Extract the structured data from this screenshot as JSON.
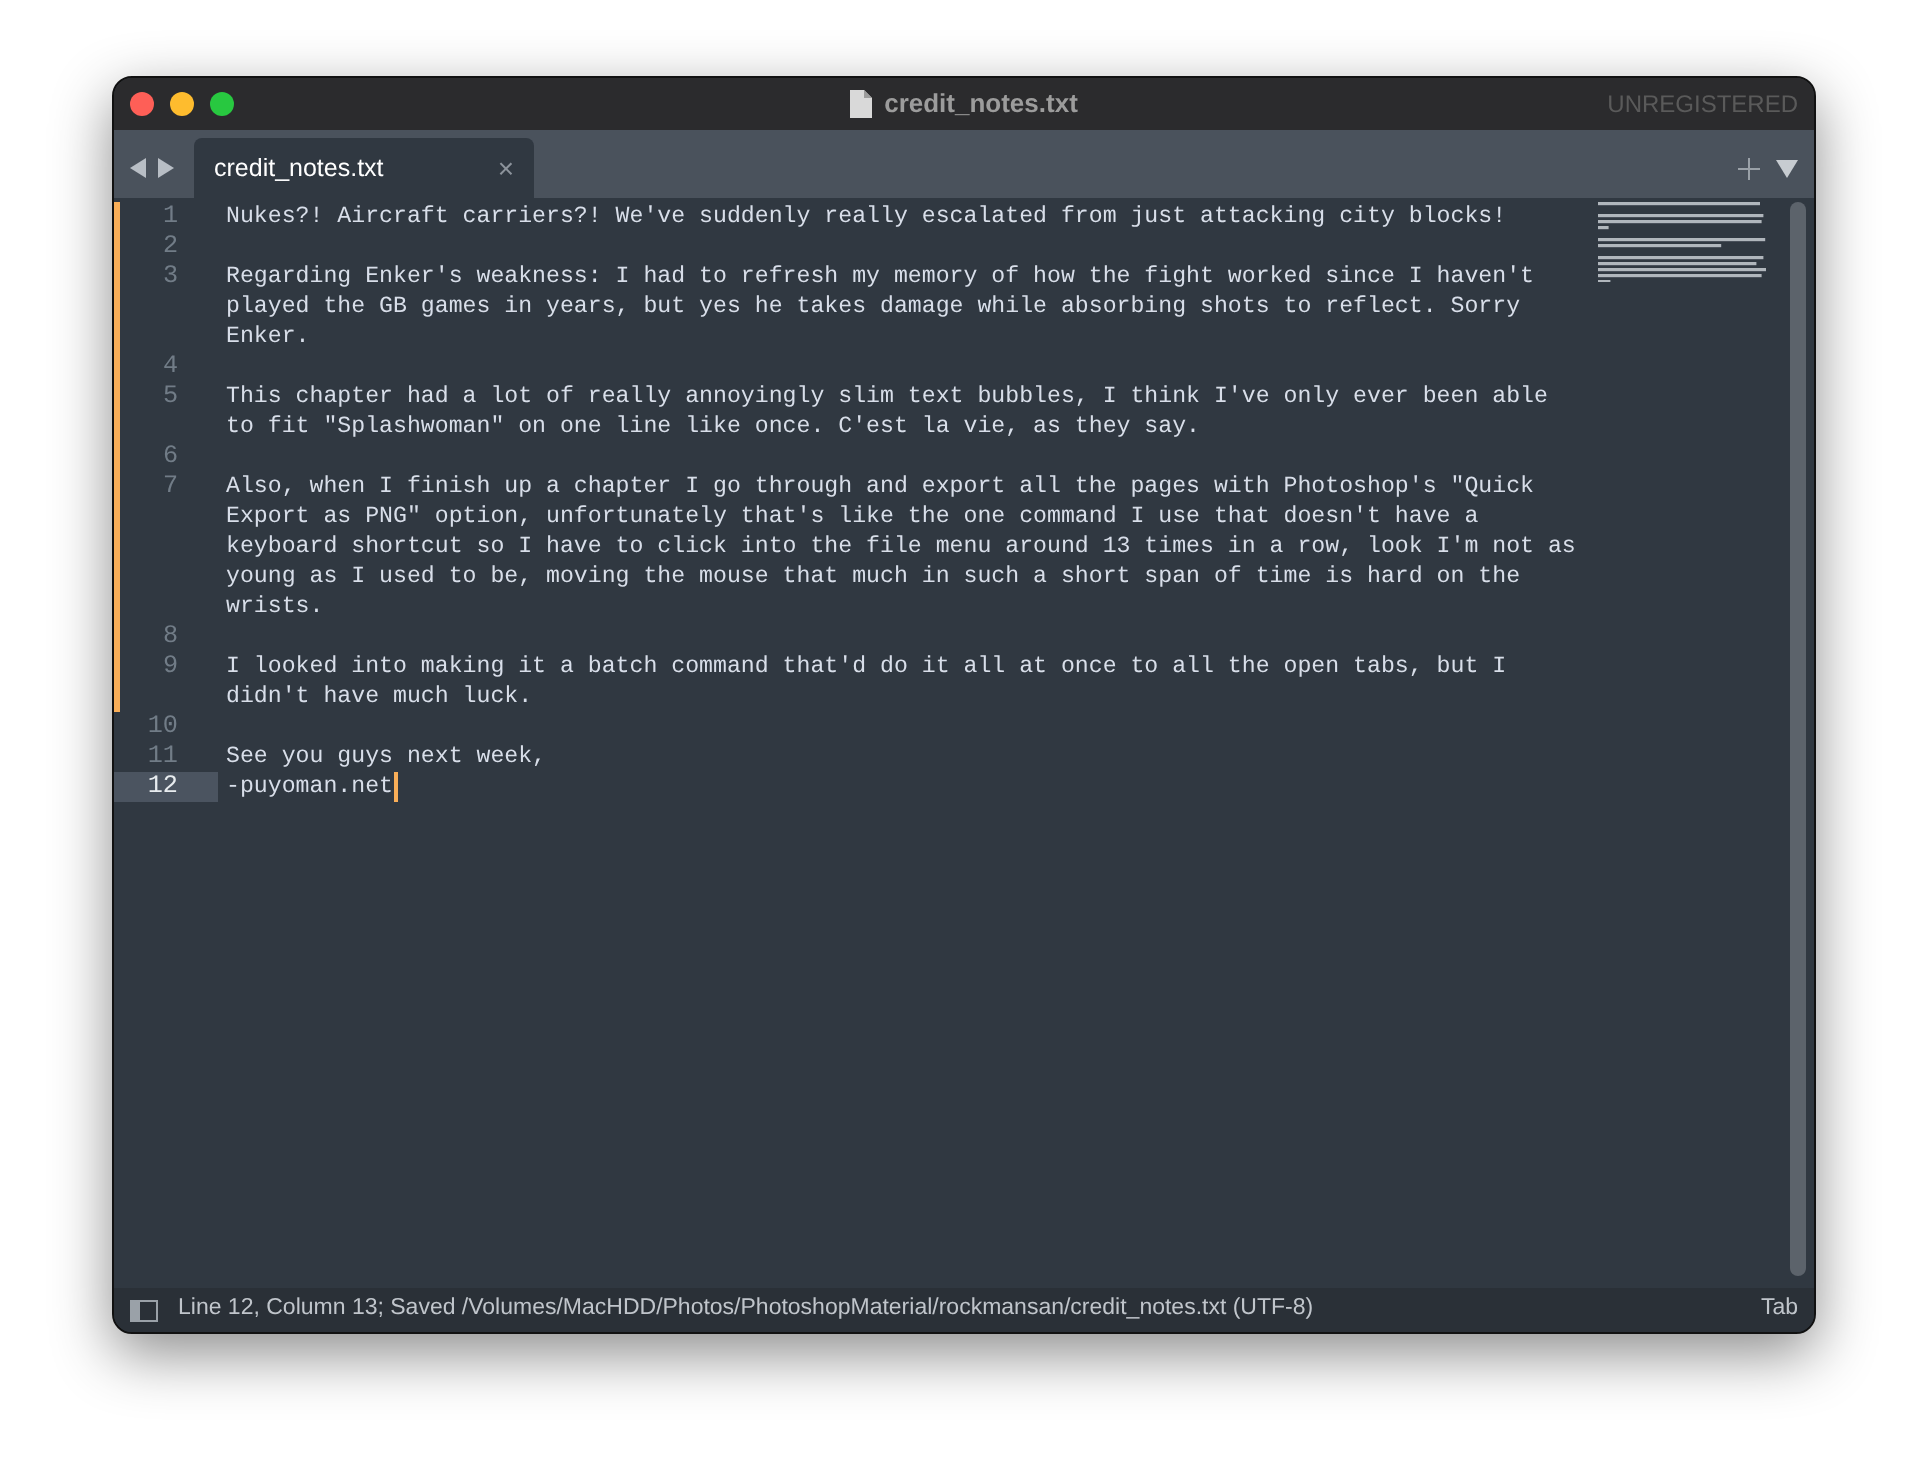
{
  "window": {
    "title": "credit_notes.txt",
    "registration": "UNREGISTERED"
  },
  "tabs": [
    {
      "label": "credit_notes.txt",
      "selected": true,
      "close": "×"
    }
  ],
  "editor": {
    "lines": [
      {
        "number": "1",
        "segments": [
          "Nukes?! Aircraft carriers?! We've suddenly really escalated from just attacking city blocks!"
        ],
        "modified": true,
        "current": false
      },
      {
        "number": "2",
        "modified": true,
        "current": false
      },
      {
        "number": "3",
        "segments": [
          "Regarding Enker's weakness: I had to refresh my memory of how the fight worked since I haven't",
          "played the GB games in years, but yes he takes damage while absorbing shots to reflect. Sorry",
          "Enker."
        ],
        "modified": true,
        "current": false
      },
      {
        "number": "4",
        "modified": true,
        "current": false
      },
      {
        "number": "5",
        "segments": [
          "This chapter had a lot of really annoyingly slim text bubbles, I think I've only ever been able",
          "to fit \"Splashwoman\" on one line like once. C'est la vie, as they say."
        ],
        "modified": true,
        "current": false
      },
      {
        "number": "6",
        "modified": true,
        "current": false
      },
      {
        "number": "7",
        "segments": [
          "Also, when I finish up a chapter I go through and export all the pages with Photoshop's \"Quick",
          "Export as PNG\" option, unfortunately that's like the one command I use that doesn't have a",
          "keyboard shortcut so I have to click into the file menu around 13 times in a row, look I'm not as",
          "young as I used to be, moving the mouse that much in such a short span of time is hard on the",
          "wrists."
        ],
        "modified": true,
        "current": false
      },
      {
        "number": "8",
        "modified": true,
        "current": false
      },
      {
        "number": "9",
        "segments": [
          "I looked into making it a batch command that'd do it all at once to all the open tabs, but I",
          "didn't have much luck."
        ],
        "modified": true,
        "current": false
      },
      {
        "number": "10",
        "modified": false,
        "current": false
      },
      {
        "number": "11",
        "segments": [
          "See you guys next week,"
        ],
        "modified": false,
        "current": false
      },
      {
        "number": "12",
        "segments": [
          "-puyoman.net"
        ],
        "modified": false,
        "current": true
      }
    ]
  },
  "status_bar": {
    "text": "Line 12, Column 13; Saved /Volumes/MacHDD/Photos/PhotoshopMaterial/rockmansan/credit_notes.txt (UTF-8)",
    "right": "Tab"
  }
}
